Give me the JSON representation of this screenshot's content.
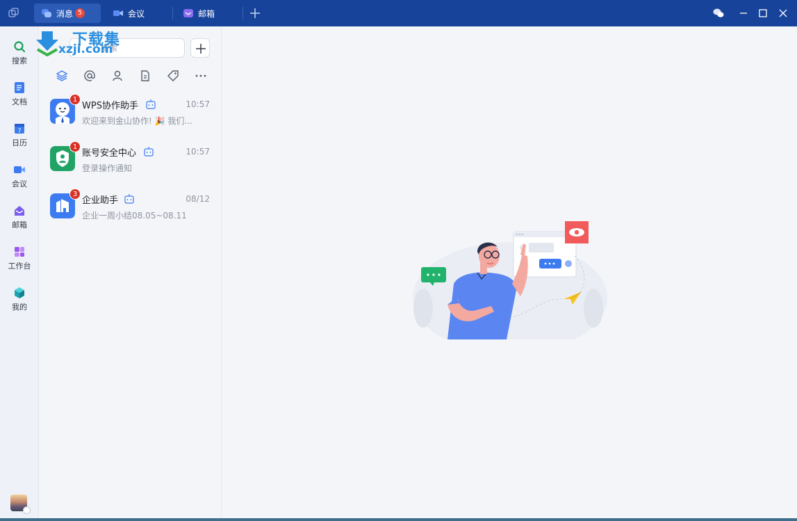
{
  "titlebar": {
    "tabs": [
      {
        "label": "消息",
        "badge": "5",
        "active": true
      },
      {
        "label": "会议",
        "active": false
      },
      {
        "label": "邮箱",
        "active": false
      }
    ]
  },
  "nav": {
    "items": [
      {
        "label": "搜索",
        "icon": "search-icon"
      },
      {
        "label": "文档",
        "icon": "document-icon"
      },
      {
        "label": "日历",
        "icon": "calendar-icon"
      },
      {
        "label": "会议",
        "icon": "meeting-icon"
      },
      {
        "label": "邮箱",
        "icon": "mail-icon"
      },
      {
        "label": "工作台",
        "icon": "workbench-icon"
      },
      {
        "label": "我的",
        "icon": "profile-cube-icon"
      }
    ]
  },
  "search": {
    "placeholder": "搜索"
  },
  "watermark": {
    "line1": "下载集",
    "line2": "xzji.com"
  },
  "filters": [
    "layers-icon",
    "at-icon",
    "person-icon",
    "file-icon",
    "tag-icon",
    "more-icon"
  ],
  "sessions": [
    {
      "name": "WPS协作助手",
      "time": "10:57",
      "preview": "欢迎来到金山协作! 🎉 我们...",
      "badge": "1",
      "icon_color": "#3d7cf0"
    },
    {
      "name": "账号安全中心",
      "time": "10:57",
      "preview": "登录操作通知",
      "badge": "1",
      "icon_color": "#21a366"
    },
    {
      "name": "企业助手",
      "time": "08/12",
      "preview": "企业一周小结08.05~08.11",
      "badge": "3",
      "icon_color": "#3d7cf0"
    }
  ],
  "colors": {
    "titlebar": "#17439a",
    "accent": "#3d7cf0",
    "badge": "#d93026"
  }
}
